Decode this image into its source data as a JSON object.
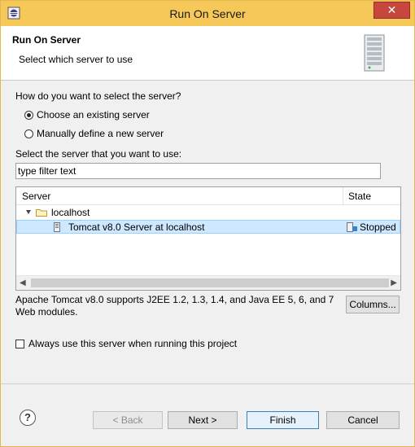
{
  "window": {
    "title": "Run On Server",
    "close_glyph": "✕"
  },
  "header": {
    "title": "Run On Server",
    "subtitle": "Select which server to use"
  },
  "selection": {
    "question": "How do you want to select the server?",
    "option_existing": "Choose an existing server",
    "option_manual": "Manually define a new server",
    "selected": "existing"
  },
  "server_list": {
    "label": "Select the server that you want to use:",
    "filter_value": "type filter text",
    "columns": [
      "Server",
      "State"
    ],
    "rows": [
      {
        "name": "localhost",
        "type": "folder",
        "expanded": true
      },
      {
        "name": "Tomcat v8.0 Server at localhost",
        "state": "Stopped",
        "selected": true
      }
    ]
  },
  "description": "Apache Tomcat v8.0 supports J2EE 1.2, 1.3, 1.4, and Java EE 5, 6, and 7 Web modules.",
  "columns_button": "Columns...",
  "always_use": {
    "label": "Always use this server when running this project",
    "checked": false
  },
  "buttons": {
    "back": "< Back",
    "next": "Next >",
    "finish": "Finish",
    "cancel": "Cancel",
    "help": "?"
  },
  "colors": {
    "titlebar": "#f6c859",
    "selection": "#cde8ff",
    "close": "#c7463e"
  }
}
